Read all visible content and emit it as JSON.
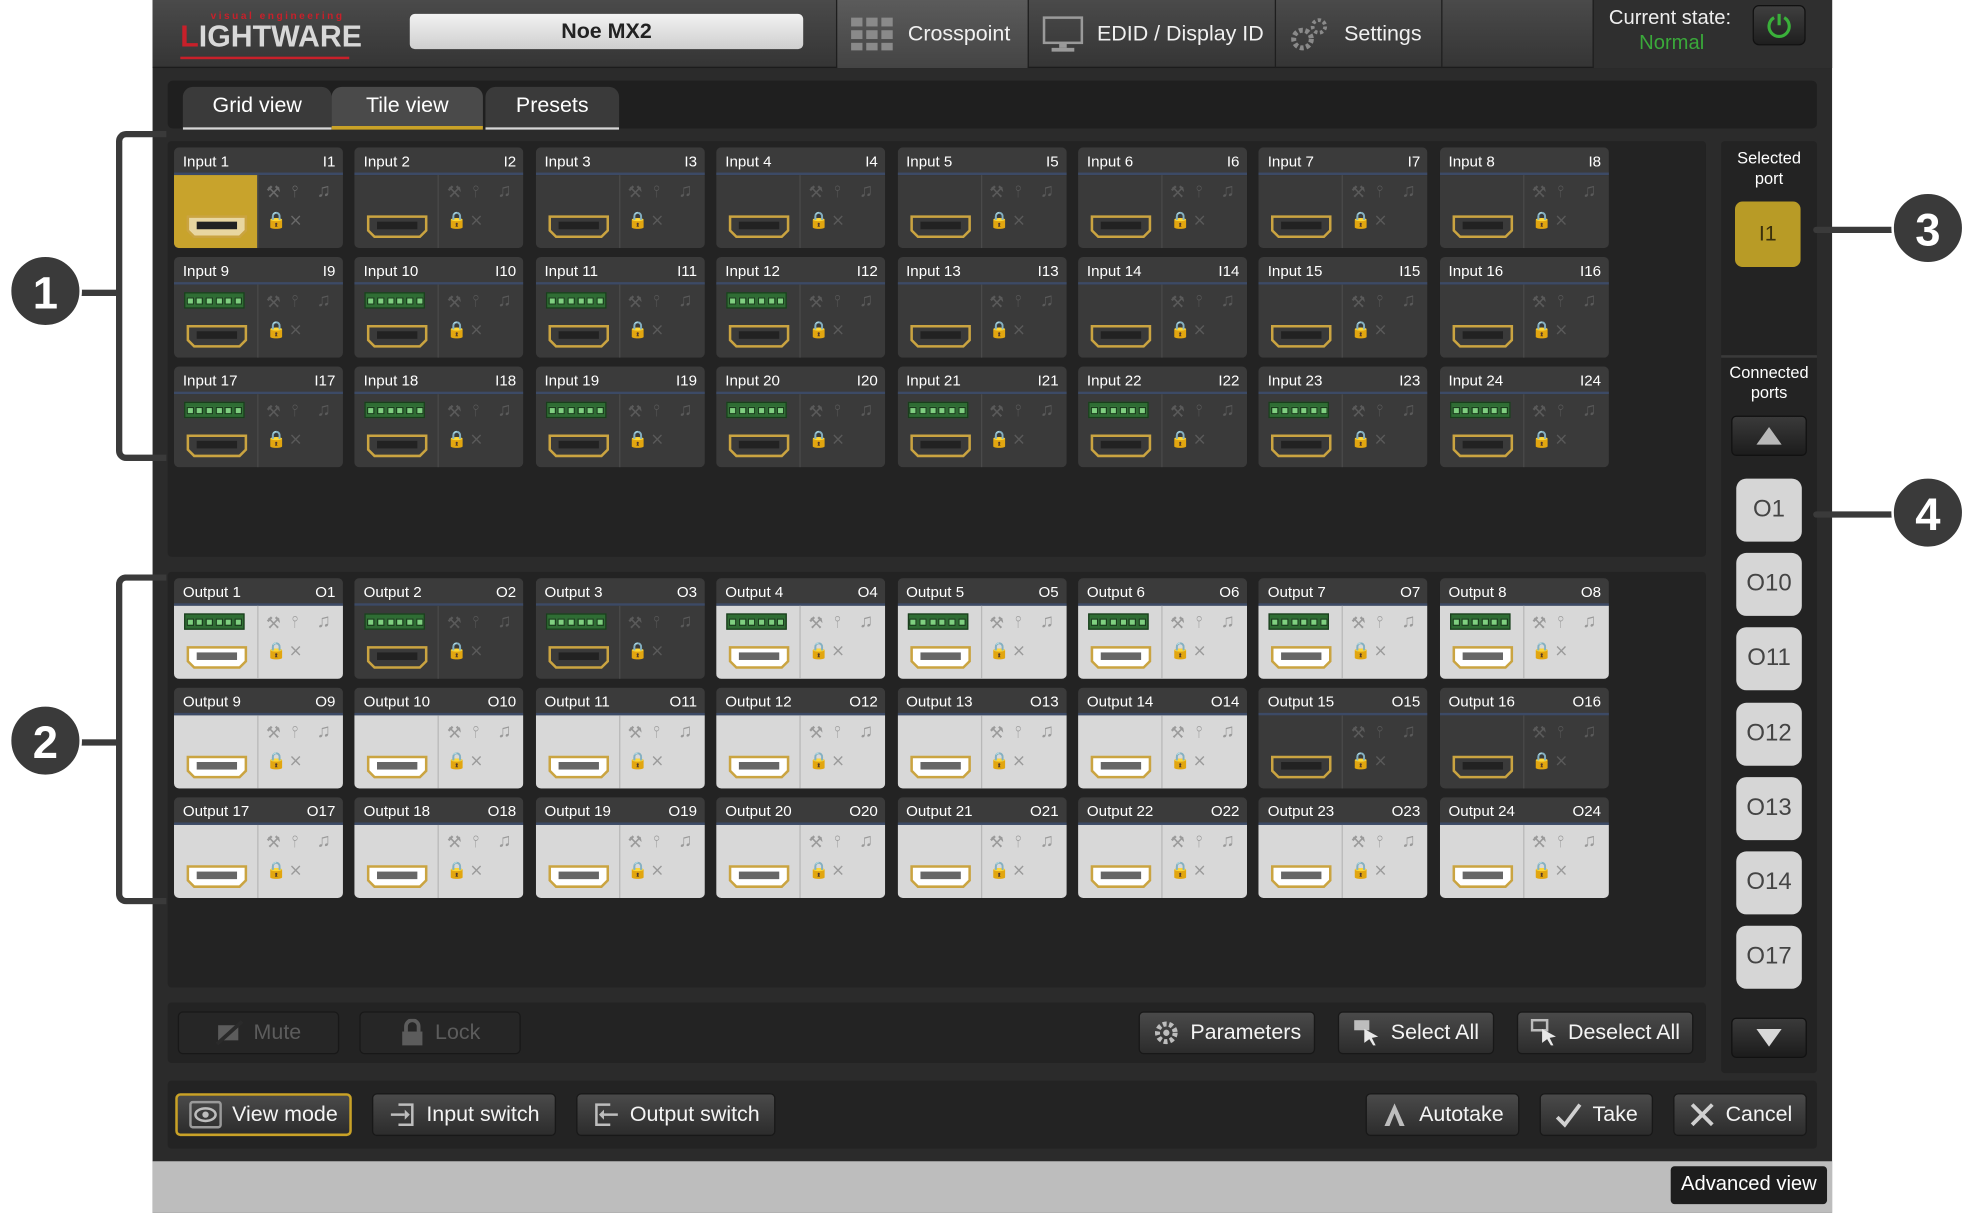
{
  "header": {
    "logo_tagline": "visual engineering",
    "logo_word_first": "L",
    "logo_word_rest": "IGHTWARE",
    "device_name": "Noe MX2",
    "nav": [
      {
        "label": "Crosspoint",
        "icon": "grid-icon"
      },
      {
        "label": "EDID / Display ID",
        "icon": "monitor-icon"
      },
      {
        "label": "Settings",
        "icon": "gears-icon"
      }
    ],
    "state_label": "Current state:",
    "state_value": "Normal",
    "state_color": "#3aa93a"
  },
  "tabs": [
    {
      "label": "Grid view",
      "active": false
    },
    {
      "label": "Tile view",
      "active": true
    },
    {
      "label": "Presets",
      "active": false
    }
  ],
  "inputs": [
    {
      "name": "Input 1",
      "code": "I1",
      "phoenix": false,
      "selected": true,
      "light": false
    },
    {
      "name": "Input 2",
      "code": "I2",
      "phoenix": false
    },
    {
      "name": "Input 3",
      "code": "I3",
      "phoenix": false
    },
    {
      "name": "Input 4",
      "code": "I4",
      "phoenix": false
    },
    {
      "name": "Input 5",
      "code": "I5",
      "phoenix": false
    },
    {
      "name": "Input 6",
      "code": "I6",
      "phoenix": false
    },
    {
      "name": "Input 7",
      "code": "I7",
      "phoenix": false
    },
    {
      "name": "Input 8",
      "code": "I8",
      "phoenix": false
    },
    {
      "name": "Input 9",
      "code": "I9",
      "phoenix": true
    },
    {
      "name": "Input 10",
      "code": "I10",
      "phoenix": true
    },
    {
      "name": "Input 11",
      "code": "I11",
      "phoenix": true
    },
    {
      "name": "Input 12",
      "code": "I12",
      "phoenix": true
    },
    {
      "name": "Input 13",
      "code": "I13",
      "phoenix": false
    },
    {
      "name": "Input 14",
      "code": "I14",
      "phoenix": false
    },
    {
      "name": "Input 15",
      "code": "I15",
      "phoenix": false
    },
    {
      "name": "Input 16",
      "code": "I16",
      "phoenix": false
    },
    {
      "name": "Input 17",
      "code": "I17",
      "phoenix": true
    },
    {
      "name": "Input 18",
      "code": "I18",
      "phoenix": true
    },
    {
      "name": "Input 19",
      "code": "I19",
      "phoenix": true
    },
    {
      "name": "Input 20",
      "code": "I20",
      "phoenix": true
    },
    {
      "name": "Input 21",
      "code": "I21",
      "phoenix": true
    },
    {
      "name": "Input 22",
      "code": "I22",
      "phoenix": true
    },
    {
      "name": "Input 23",
      "code": "I23",
      "phoenix": true
    },
    {
      "name": "Input 24",
      "code": "I24",
      "phoenix": true
    }
  ],
  "outputs": [
    {
      "name": "Output 1",
      "code": "O1",
      "phoenix": true,
      "light": true
    },
    {
      "name": "Output 2",
      "code": "O2",
      "phoenix": true,
      "light": false
    },
    {
      "name": "Output 3",
      "code": "O3",
      "phoenix": true,
      "light": false
    },
    {
      "name": "Output 4",
      "code": "O4",
      "phoenix": true,
      "light": true
    },
    {
      "name": "Output 5",
      "code": "O5",
      "phoenix": true,
      "light": true
    },
    {
      "name": "Output 6",
      "code": "O6",
      "phoenix": true,
      "light": true
    },
    {
      "name": "Output 7",
      "code": "O7",
      "phoenix": true,
      "light": true
    },
    {
      "name": "Output 8",
      "code": "O8",
      "phoenix": true,
      "light": true
    },
    {
      "name": "Output 9",
      "code": "O9",
      "phoenix": false,
      "light": true
    },
    {
      "name": "Output 10",
      "code": "O10",
      "phoenix": false,
      "light": true
    },
    {
      "name": "Output 11",
      "code": "O11",
      "phoenix": false,
      "light": true
    },
    {
      "name": "Output 12",
      "code": "O12",
      "phoenix": false,
      "light": true
    },
    {
      "name": "Output 13",
      "code": "O13",
      "phoenix": false,
      "light": true
    },
    {
      "name": "Output 14",
      "code": "O14",
      "phoenix": false,
      "light": true
    },
    {
      "name": "Output 15",
      "code": "O15",
      "phoenix": false,
      "light": false
    },
    {
      "name": "Output 16",
      "code": "O16",
      "phoenix": false,
      "light": false
    },
    {
      "name": "Output 17",
      "code": "O17",
      "phoenix": false,
      "light": true
    },
    {
      "name": "Output 18",
      "code": "O18",
      "phoenix": false,
      "light": true
    },
    {
      "name": "Output 19",
      "code": "O19",
      "phoenix": false,
      "light": true
    },
    {
      "name": "Output 20",
      "code": "O20",
      "phoenix": false,
      "light": true
    },
    {
      "name": "Output 21",
      "code": "O21",
      "phoenix": false,
      "light": true
    },
    {
      "name": "Output 22",
      "code": "O22",
      "phoenix": false,
      "light": true
    },
    {
      "name": "Output 23",
      "code": "O23",
      "phoenix": false,
      "light": true
    },
    {
      "name": "Output 24",
      "code": "O24",
      "phoenix": false,
      "light": true
    }
  ],
  "side": {
    "selected_label": "Selected port",
    "selected_port": "I1",
    "connected_label": "Connected ports",
    "connected_ports": [
      "O1",
      "O10",
      "O11",
      "O12",
      "O13",
      "O14",
      "O17"
    ]
  },
  "actions": {
    "mute": "Mute",
    "lock": "Lock",
    "parameters": "Parameters",
    "select_all": "Select All",
    "deselect_all": "Deselect All"
  },
  "bottom": {
    "view_mode": "View mode",
    "input_switch": "Input switch",
    "output_switch": "Output switch",
    "autotake": "Autotake",
    "take": "Take",
    "cancel": "Cancel"
  },
  "status": {
    "advanced_view": "Advanced view"
  },
  "callouts": [
    "1",
    "2",
    "3",
    "4"
  ],
  "colors": {
    "accent": "#c9a227",
    "selected": "#c8a32c",
    "dark_bg": "#2b2b2b"
  }
}
